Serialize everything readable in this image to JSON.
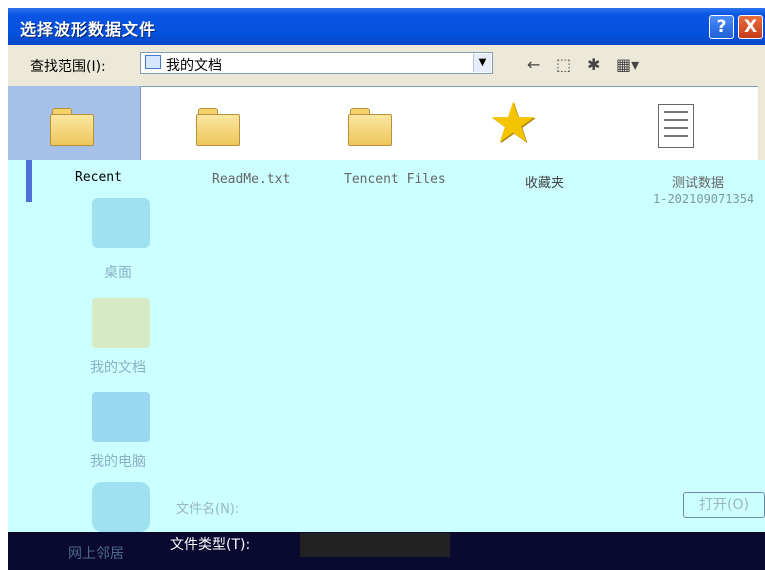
{
  "window": {
    "title": "选择波形数据文件",
    "help_label": "?",
    "close_label": "X"
  },
  "toolbar": {
    "lookin_label": "查找范围(I):",
    "lookin_value": "我的文档",
    "back_icon": "back-arrow-icon",
    "up_icon": "up-folder-icon",
    "new_folder_icon": "new-folder-icon",
    "views_icon": "views-menu-icon"
  },
  "places": {
    "recent": "Recent",
    "desktop": "桌面",
    "my_documents": "我的文档",
    "my_computer": "我的电脑",
    "network": "网上邻居"
  },
  "files": [
    {
      "name": "ReadMe.txt",
      "icon": "folder-icon"
    },
    {
      "name": "Tencent Files",
      "icon": "folder-icon"
    },
    {
      "name": "收藏夹",
      "icon": "star-icon"
    },
    {
      "name": "测试数据",
      "icon": "document-icon",
      "sub": "1-202109071354"
    }
  ],
  "bottom": {
    "filename_label": "文件名(N):",
    "open_button": "打开(O)",
    "filetype_label": "文件类型(T):",
    "filetype_value": ""
  },
  "colors": {
    "title_bar": "#0451dd",
    "dialog_bg": "#ece9d8",
    "overlay_cyan": "#ccffff"
  }
}
